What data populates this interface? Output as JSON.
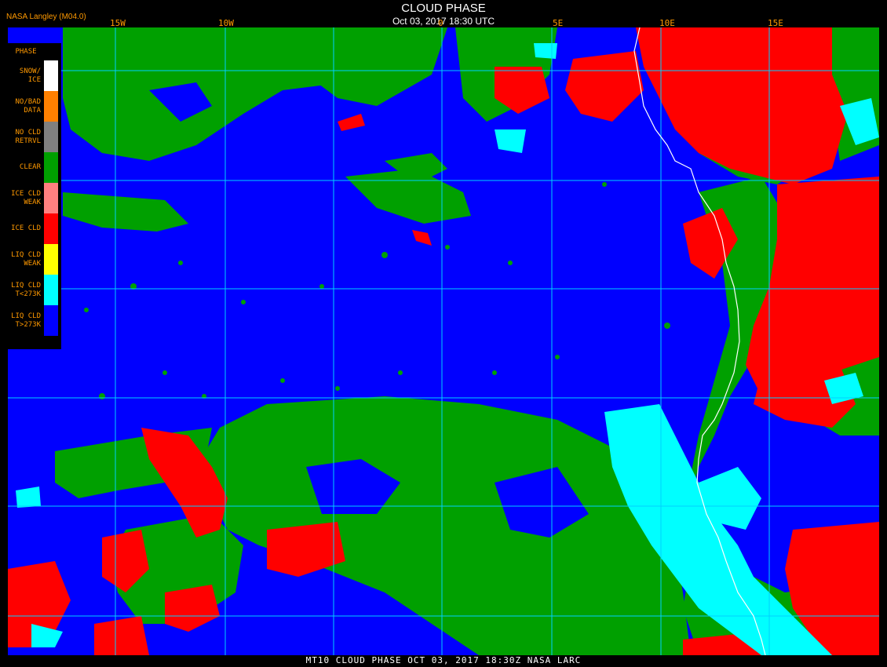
{
  "header": {
    "title": "CLOUD PHASE",
    "datetime": "Oct 03, 2017 18:30 UTC",
    "credit": "NASA Langley (M04.0)"
  },
  "lon_labels": [
    "15W",
    "10W",
    "0",
    "5E",
    "10E",
    "15E"
  ],
  "legend": {
    "title": "PHASE",
    "items": [
      {
        "line1": "SNOW/",
        "line2": "ICE",
        "color": "#ffffff"
      },
      {
        "line1": "NO/BAD",
        "line2": "DATA",
        "color": "#ff8000"
      },
      {
        "line1": "NO CLD",
        "line2": "RETRVL",
        "color": "#808080"
      },
      {
        "line1": "CLEAR",
        "line2": "",
        "color": "#00a000"
      },
      {
        "line1": "ICE CLD",
        "line2": "WEAK",
        "color": "#ff8080"
      },
      {
        "line1": "ICE CLD",
        "line2": "",
        "color": "#ff0000"
      },
      {
        "line1": "LIQ CLD",
        "line2": "WEAK",
        "color": "#ffff00"
      },
      {
        "line1": "LIQ CLD",
        "line2": "T<273K",
        "color": "#00ffff"
      },
      {
        "line1": "LIQ CLD",
        "line2": "T>273K",
        "color": "#0000ff"
      }
    ]
  },
  "footer": "MT10  CLOUD PHASE   OCT 03, 2017 18:30Z   NASA LARC",
  "colors": {
    "grid": "#00d0ff",
    "coastline": "#ffffff",
    "clear": "#00a000",
    "ice": "#ff0000",
    "liquid_cold": "#00ffff",
    "liquid_warm": "#0000ff"
  }
}
